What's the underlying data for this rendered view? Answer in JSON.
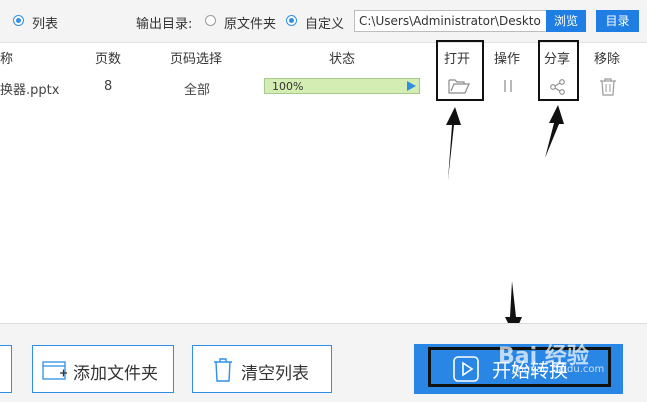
{
  "toolbar": {
    "list_view_label": "列表",
    "output_dir_label": "输出目录:",
    "option_original": "原文件夹",
    "option_custom": "自定义",
    "path_value": "C:\\Users\\Administrator\\Desktop",
    "browse_label": "浏览",
    "directory_label": "目录"
  },
  "table": {
    "headers": {
      "name": "称",
      "pages": "页数",
      "page_select": "页码选择",
      "status": "状态",
      "open": "打开",
      "operation": "操作",
      "share": "分享",
      "remove": "移除"
    },
    "rows": [
      {
        "name": "换器.pptx",
        "pages": "8",
        "page_select": "全部",
        "progress_text": "100%",
        "progress_value": 100
      }
    ]
  },
  "footer": {
    "add_folder_label": "添加文件夹",
    "clear_list_label": "清空列表",
    "start_label": "开始转换"
  },
  "watermark": {
    "text": "Bai 经验",
    "sub": "jingyan.baidu.com"
  },
  "colors": {
    "accent": "#2f8fe6",
    "progress_bg": "#e2f3cd",
    "annotation": "#111111"
  }
}
